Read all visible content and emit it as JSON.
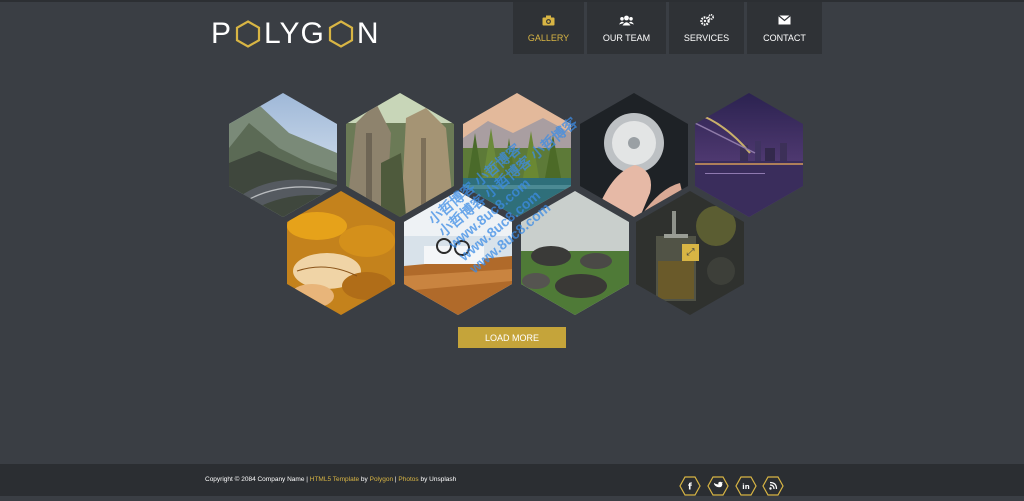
{
  "logo": {
    "letters": [
      "P",
      "LYG",
      "N"
    ]
  },
  "nav": [
    {
      "label": "GALLERY",
      "icon": "camera-icon",
      "active": true
    },
    {
      "label": "OUR TEAM",
      "icon": "users-icon",
      "active": false
    },
    {
      "label": "SERVICES",
      "icon": "gears-icon",
      "active": false
    },
    {
      "label": "CONTACT",
      "icon": "envelope-icon",
      "active": false
    }
  ],
  "gallery": {
    "items": [
      {
        "subject": "mountain road"
      },
      {
        "subject": "rock cliffs"
      },
      {
        "subject": "lake with forest"
      },
      {
        "subject": "dandelion in hand"
      },
      {
        "subject": "city bridge at night"
      },
      {
        "subject": "autumn leaves"
      },
      {
        "subject": "glasses on desk"
      },
      {
        "subject": "rocks on grass"
      },
      {
        "subject": "coffee press"
      }
    ],
    "zoom_icon": "expand-icon"
  },
  "load_more": "LOAD MORE",
  "watermark": {
    "lines": [
      "小哲博客 小哲博客",
      "小哲博客 小哲博客 小哲博客",
      "www.8uc8.com",
      "www.8uc8.com",
      "www.8uc8.com"
    ]
  },
  "footer": {
    "copyright_prefix": "Copyright © 2084 Company Name | ",
    "template_link": "HTML5 Template",
    "by1": " by ",
    "polygon_link": "Polygon",
    "sep": " | ",
    "photos_link": "Photos",
    "by2": " by Unsplash",
    "social": [
      "facebook-icon",
      "twitter-icon",
      "linkedin-icon",
      "rss-icon"
    ]
  },
  "colors": {
    "background": "#3a3e44",
    "accent": "#d8b544",
    "nav_bg": "#2f3236",
    "footer_bg": "#2b2e32"
  }
}
